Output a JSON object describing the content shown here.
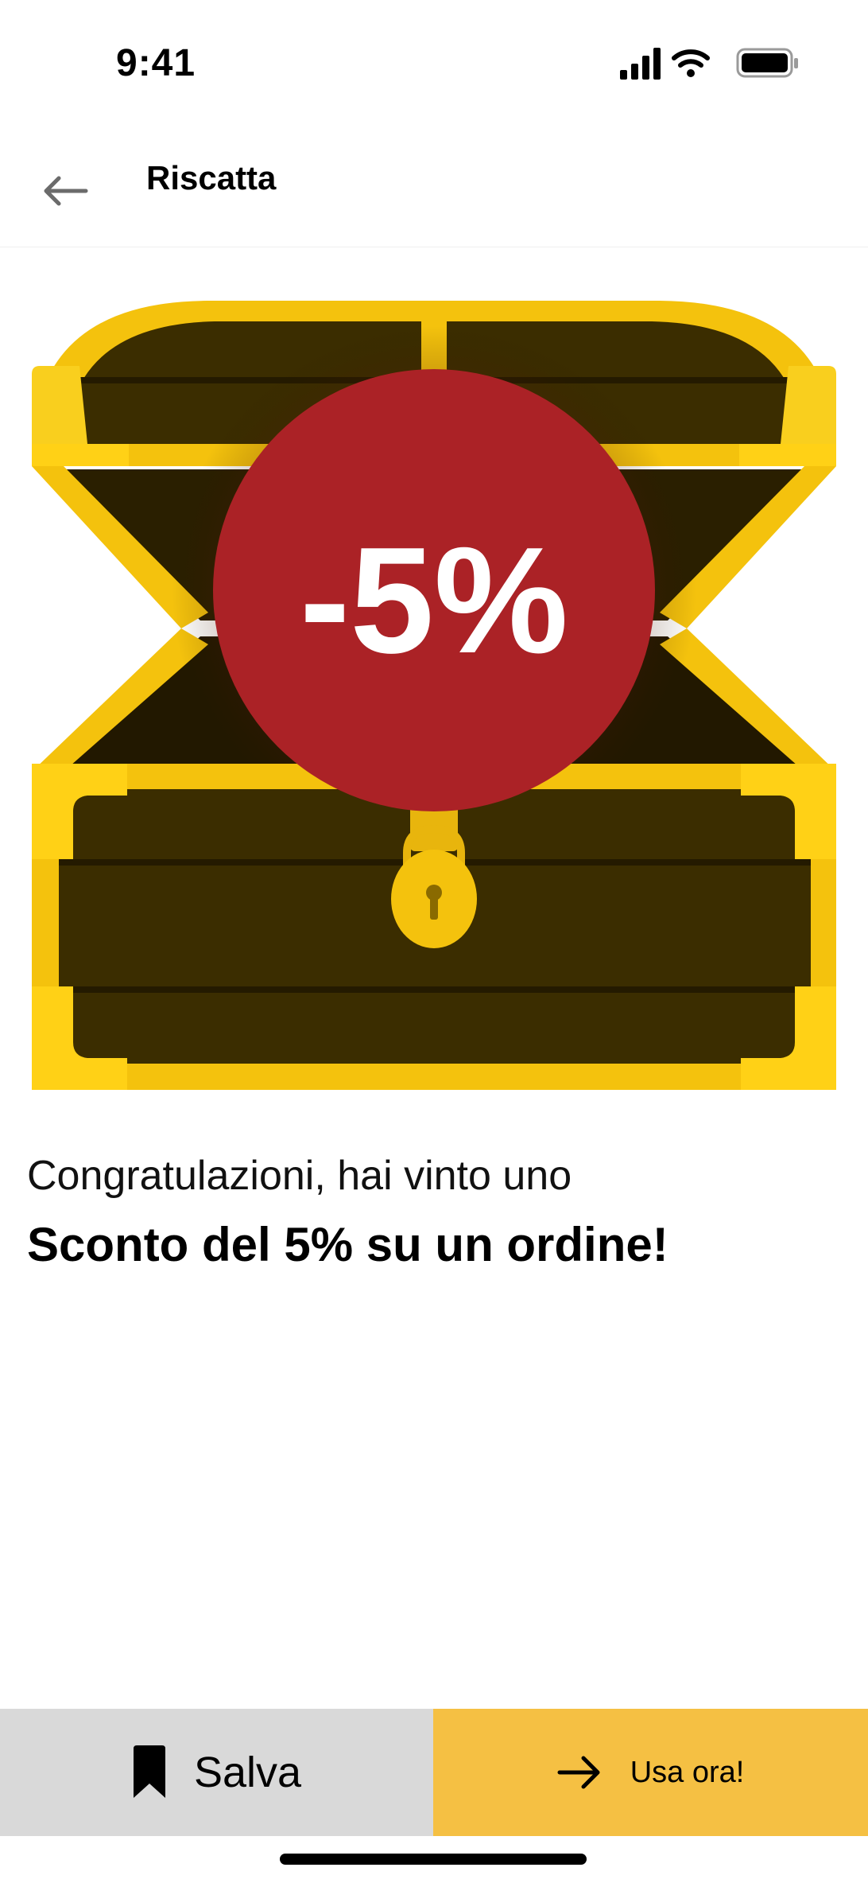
{
  "status_bar": {
    "time": "9:41",
    "icons": [
      "signal-icon",
      "wifi-icon",
      "battery-icon"
    ]
  },
  "header": {
    "title": "Riscatta",
    "back_icon": "arrow-left-icon"
  },
  "badge": {
    "text": "-5%",
    "color": "#ab2226"
  },
  "colors": {
    "gold": "#f4c20d",
    "wood": "#3b2d00",
    "accent_button": "#f5c043",
    "secondary_button": "#d9d9d9"
  },
  "message": {
    "congrats": "Congratulazioni, hai vinto uno",
    "prize": "Sconto del 5% su un ordine!"
  },
  "actions": {
    "save_label": "Salva",
    "save_icon": "bookmark-icon",
    "use_label": "Usa ora!",
    "use_icon": "arrow-right-icon"
  }
}
